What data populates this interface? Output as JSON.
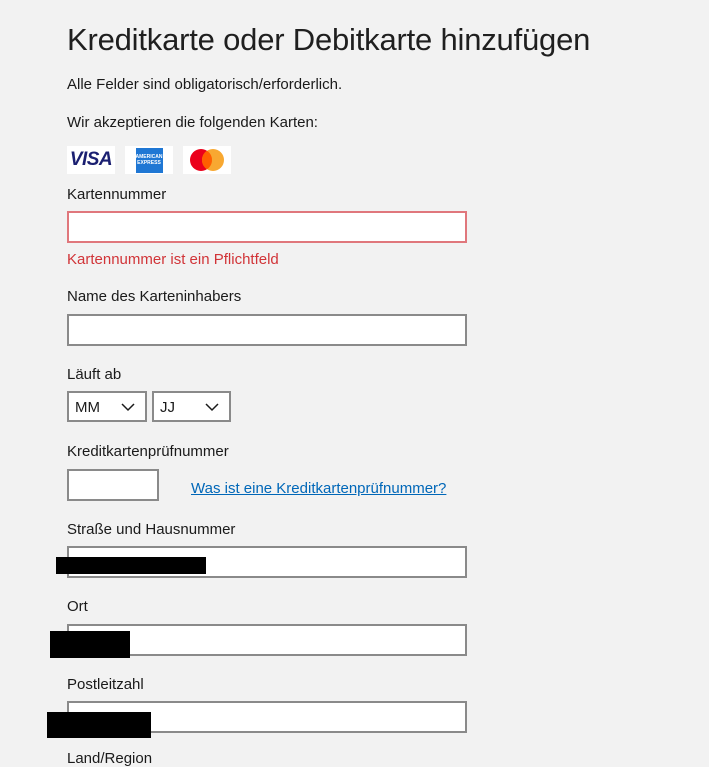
{
  "form": {
    "title": "Kreditkarte oder Debitkarte hinzufügen",
    "required_note": "Alle Felder sind obligatorisch/erforderlich.",
    "accepted_cards_label": "Wir akzeptieren die folgenden Karten:",
    "cards": [
      {
        "name": "VISA",
        "icon": "visa-logo"
      },
      {
        "name": "American Express",
        "icon": "amex-logo"
      },
      {
        "name": "Mastercard",
        "icon": "mastercard-logo"
      }
    ],
    "card_number": {
      "label": "Kartennummer",
      "value": "",
      "error": "Kartennummer ist ein Pflichtfeld"
    },
    "cardholder": {
      "label": "Name des Karteninhabers",
      "value": ""
    },
    "expiry": {
      "label": "Läuft ab",
      "month": "MM",
      "year": "JJ"
    },
    "cvv": {
      "label": "Kreditkartenprüfnummer",
      "value": "",
      "help_link": "Was ist eine Kreditkartenprüfnummer?"
    },
    "street": {
      "label": "Straße und Hausnummer"
    },
    "city": {
      "label": "Ort"
    },
    "postal_code": {
      "label": "Postleitzahl"
    },
    "country": {
      "label": "Land/Region"
    }
  },
  "colors": {
    "error": "#d13438",
    "link": "#0067b8",
    "background": "#f2f2f2"
  }
}
